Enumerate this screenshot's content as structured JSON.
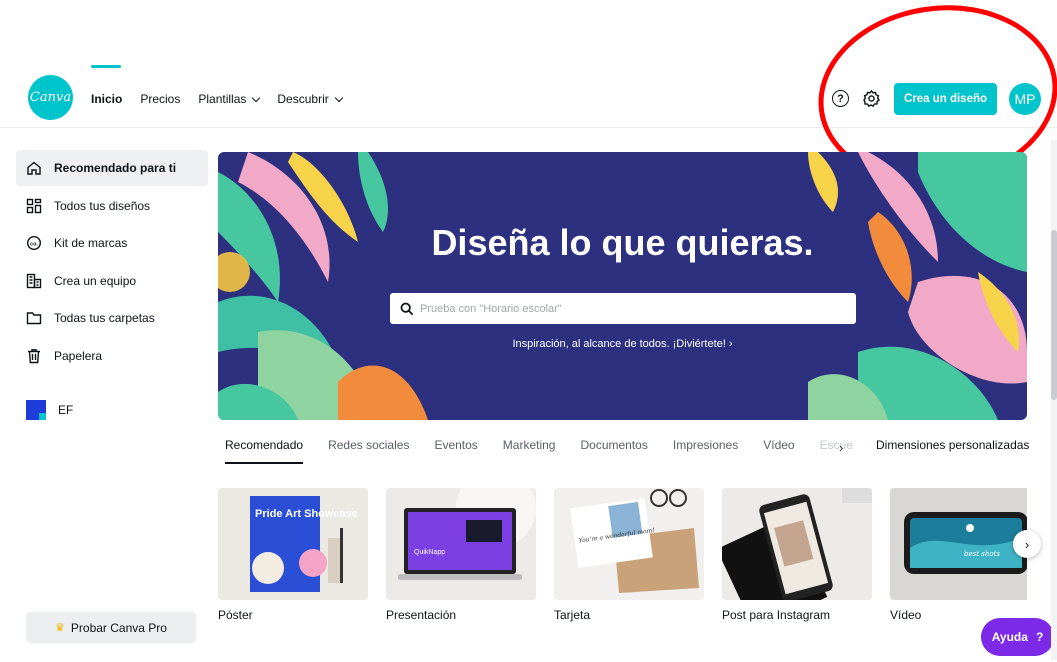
{
  "header": {
    "logo": "Canva",
    "nav": [
      {
        "label": "Inicio",
        "active": true,
        "dropdown": false
      },
      {
        "label": "Precios",
        "active": false,
        "dropdown": false
      },
      {
        "label": "Plantillas",
        "active": false,
        "dropdown": true
      },
      {
        "label": "Descubrir",
        "active": false,
        "dropdown": true
      }
    ],
    "help_symbol": "?",
    "create_button": "Crea un diseño",
    "avatar_initials": "MP"
  },
  "sidebar": {
    "items": [
      {
        "label": "Recomendado para ti",
        "icon": "home-icon",
        "active": true
      },
      {
        "label": "Todos tus diseños",
        "icon": "grid-icon",
        "active": false
      },
      {
        "label": "Kit de marcas",
        "icon": "brand-kit-icon",
        "active": false
      },
      {
        "label": "Crea un equipo",
        "icon": "team-building-icon",
        "active": false
      },
      {
        "label": "Todas tus carpetas",
        "icon": "folder-icon",
        "active": false
      },
      {
        "label": "Papelera",
        "icon": "trash-icon",
        "active": false
      }
    ],
    "team": {
      "label": "EF"
    },
    "pro_button": "Probar Canva Pro"
  },
  "hero": {
    "title": "Diseña lo que quieras.",
    "search_placeholder": "Prueba con \"Horario escolar\"",
    "subtitle": "Inspiración, al alcance de todos. ¡Diviértete! ›"
  },
  "categories": {
    "tabs": [
      "Recomendado",
      "Redes sociales",
      "Eventos",
      "Marketing",
      "Documentos",
      "Impresiones",
      "Vídeo",
      "Escue"
    ],
    "next_symbol": "›",
    "custom": "Dimensiones personalizadas"
  },
  "templates": [
    {
      "label": "Póster",
      "thumb_text": "Pride Art Showcase"
    },
    {
      "label": "Presentación",
      "thumb_text": "QuikNapp"
    },
    {
      "label": "Tarjeta",
      "thumb_text": "You're a wonderful mom!"
    },
    {
      "label": "Post para Instagram",
      "thumb_text": ""
    },
    {
      "label": "Vídeo",
      "thumb_text": "best shots"
    }
  ],
  "carousel_next": "›",
  "help_button": {
    "label": "Ayuda",
    "symbol": "?"
  },
  "colors": {
    "accent": "#00c4cc",
    "hero_bg": "#2d2f7f",
    "help": "#7d2ae8",
    "annotation": "#ff0000"
  }
}
